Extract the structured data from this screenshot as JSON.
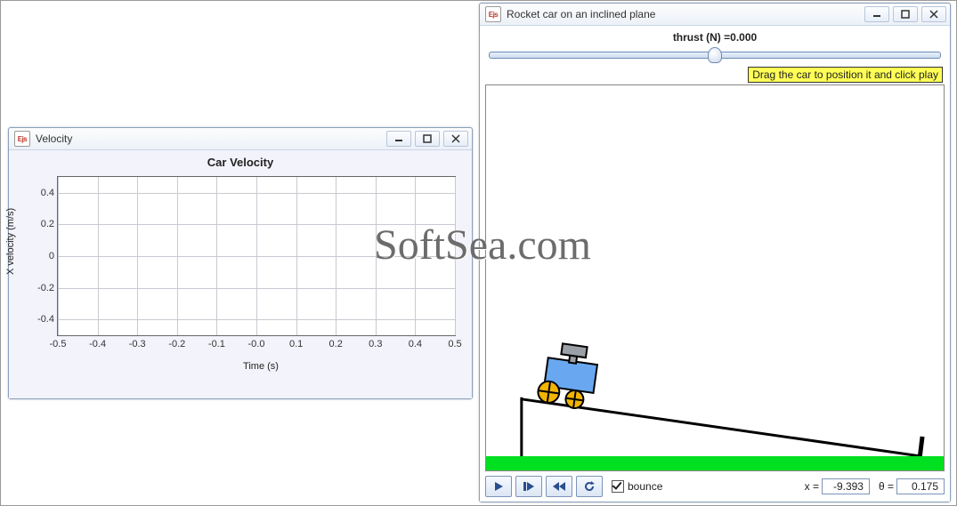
{
  "watermark_text": "SoftSea.com",
  "velocity_window": {
    "title": "Velocity",
    "app_icon_text": "Ejs"
  },
  "rocket_window": {
    "title": "Rocket car on an inclined plane",
    "app_icon_text": "Ejs",
    "thrust_label_prefix": "thrust (N) =",
    "thrust_value": "0.000",
    "slider_position_pct": 50,
    "hint": "Drag the car to position it and click play",
    "bounce_label": "bounce",
    "bounce_checked": true,
    "x_label": "x =",
    "x_value": "-9.393",
    "theta_label": "θ =",
    "theta_value": "0.175"
  },
  "chart_data": {
    "type": "line",
    "title": "Car Velocity",
    "xlabel": "Time (s)",
    "ylabel": "X velocity (m/s)",
    "xlim": [
      -0.5,
      0.5
    ],
    "ylim": [
      -0.5,
      0.5
    ],
    "xticks": [
      -0.5,
      -0.4,
      -0.3,
      -0.2,
      -0.1,
      -0.0,
      0.1,
      0.2,
      0.3,
      0.4,
      0.5
    ],
    "yticks": [
      -0.4,
      -0.2,
      0,
      0.2,
      0.4
    ],
    "series": [
      {
        "name": "X velocity",
        "x": [],
        "y": []
      }
    ]
  },
  "icon_names": {
    "minimize": "minimize-icon",
    "maximize": "maximize-icon",
    "close": "close-icon",
    "play": "play-icon",
    "step": "step-icon",
    "rewind": "rewind-icon",
    "reset": "reset-icon"
  }
}
